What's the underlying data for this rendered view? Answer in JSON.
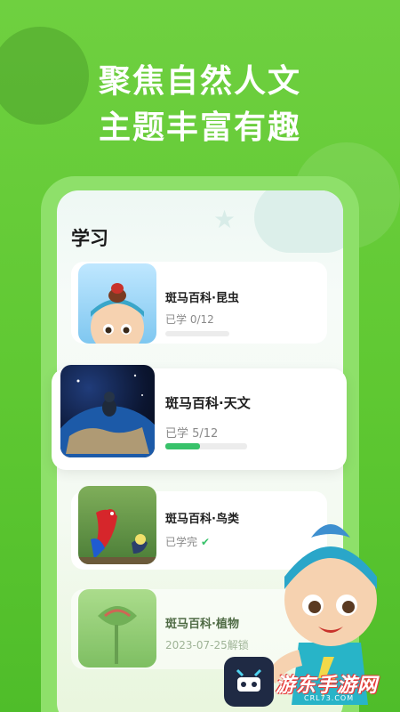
{
  "headline": {
    "line1": "聚焦自然人文",
    "line2": "主题丰富有趣"
  },
  "section": {
    "title": "学习"
  },
  "courses": [
    {
      "title": "斑马百科·昆虫",
      "status": "已学 0/12",
      "progress": 0
    },
    {
      "title": "斑马百科·天文",
      "status": "已学 5/12",
      "progress": 0.42
    },
    {
      "title": "斑马百科·鸟类",
      "status": "已学完",
      "completed": true
    },
    {
      "title": "斑马百科·植物",
      "status": "2023-07-25解锁",
      "locked": true
    }
  ],
  "watermark": {
    "brand": "游东手游网",
    "url": "CRL73.COM"
  },
  "colors": {
    "background": "#6fcf3e",
    "accent": "#38c26a",
    "text": "#1e1e1e"
  }
}
